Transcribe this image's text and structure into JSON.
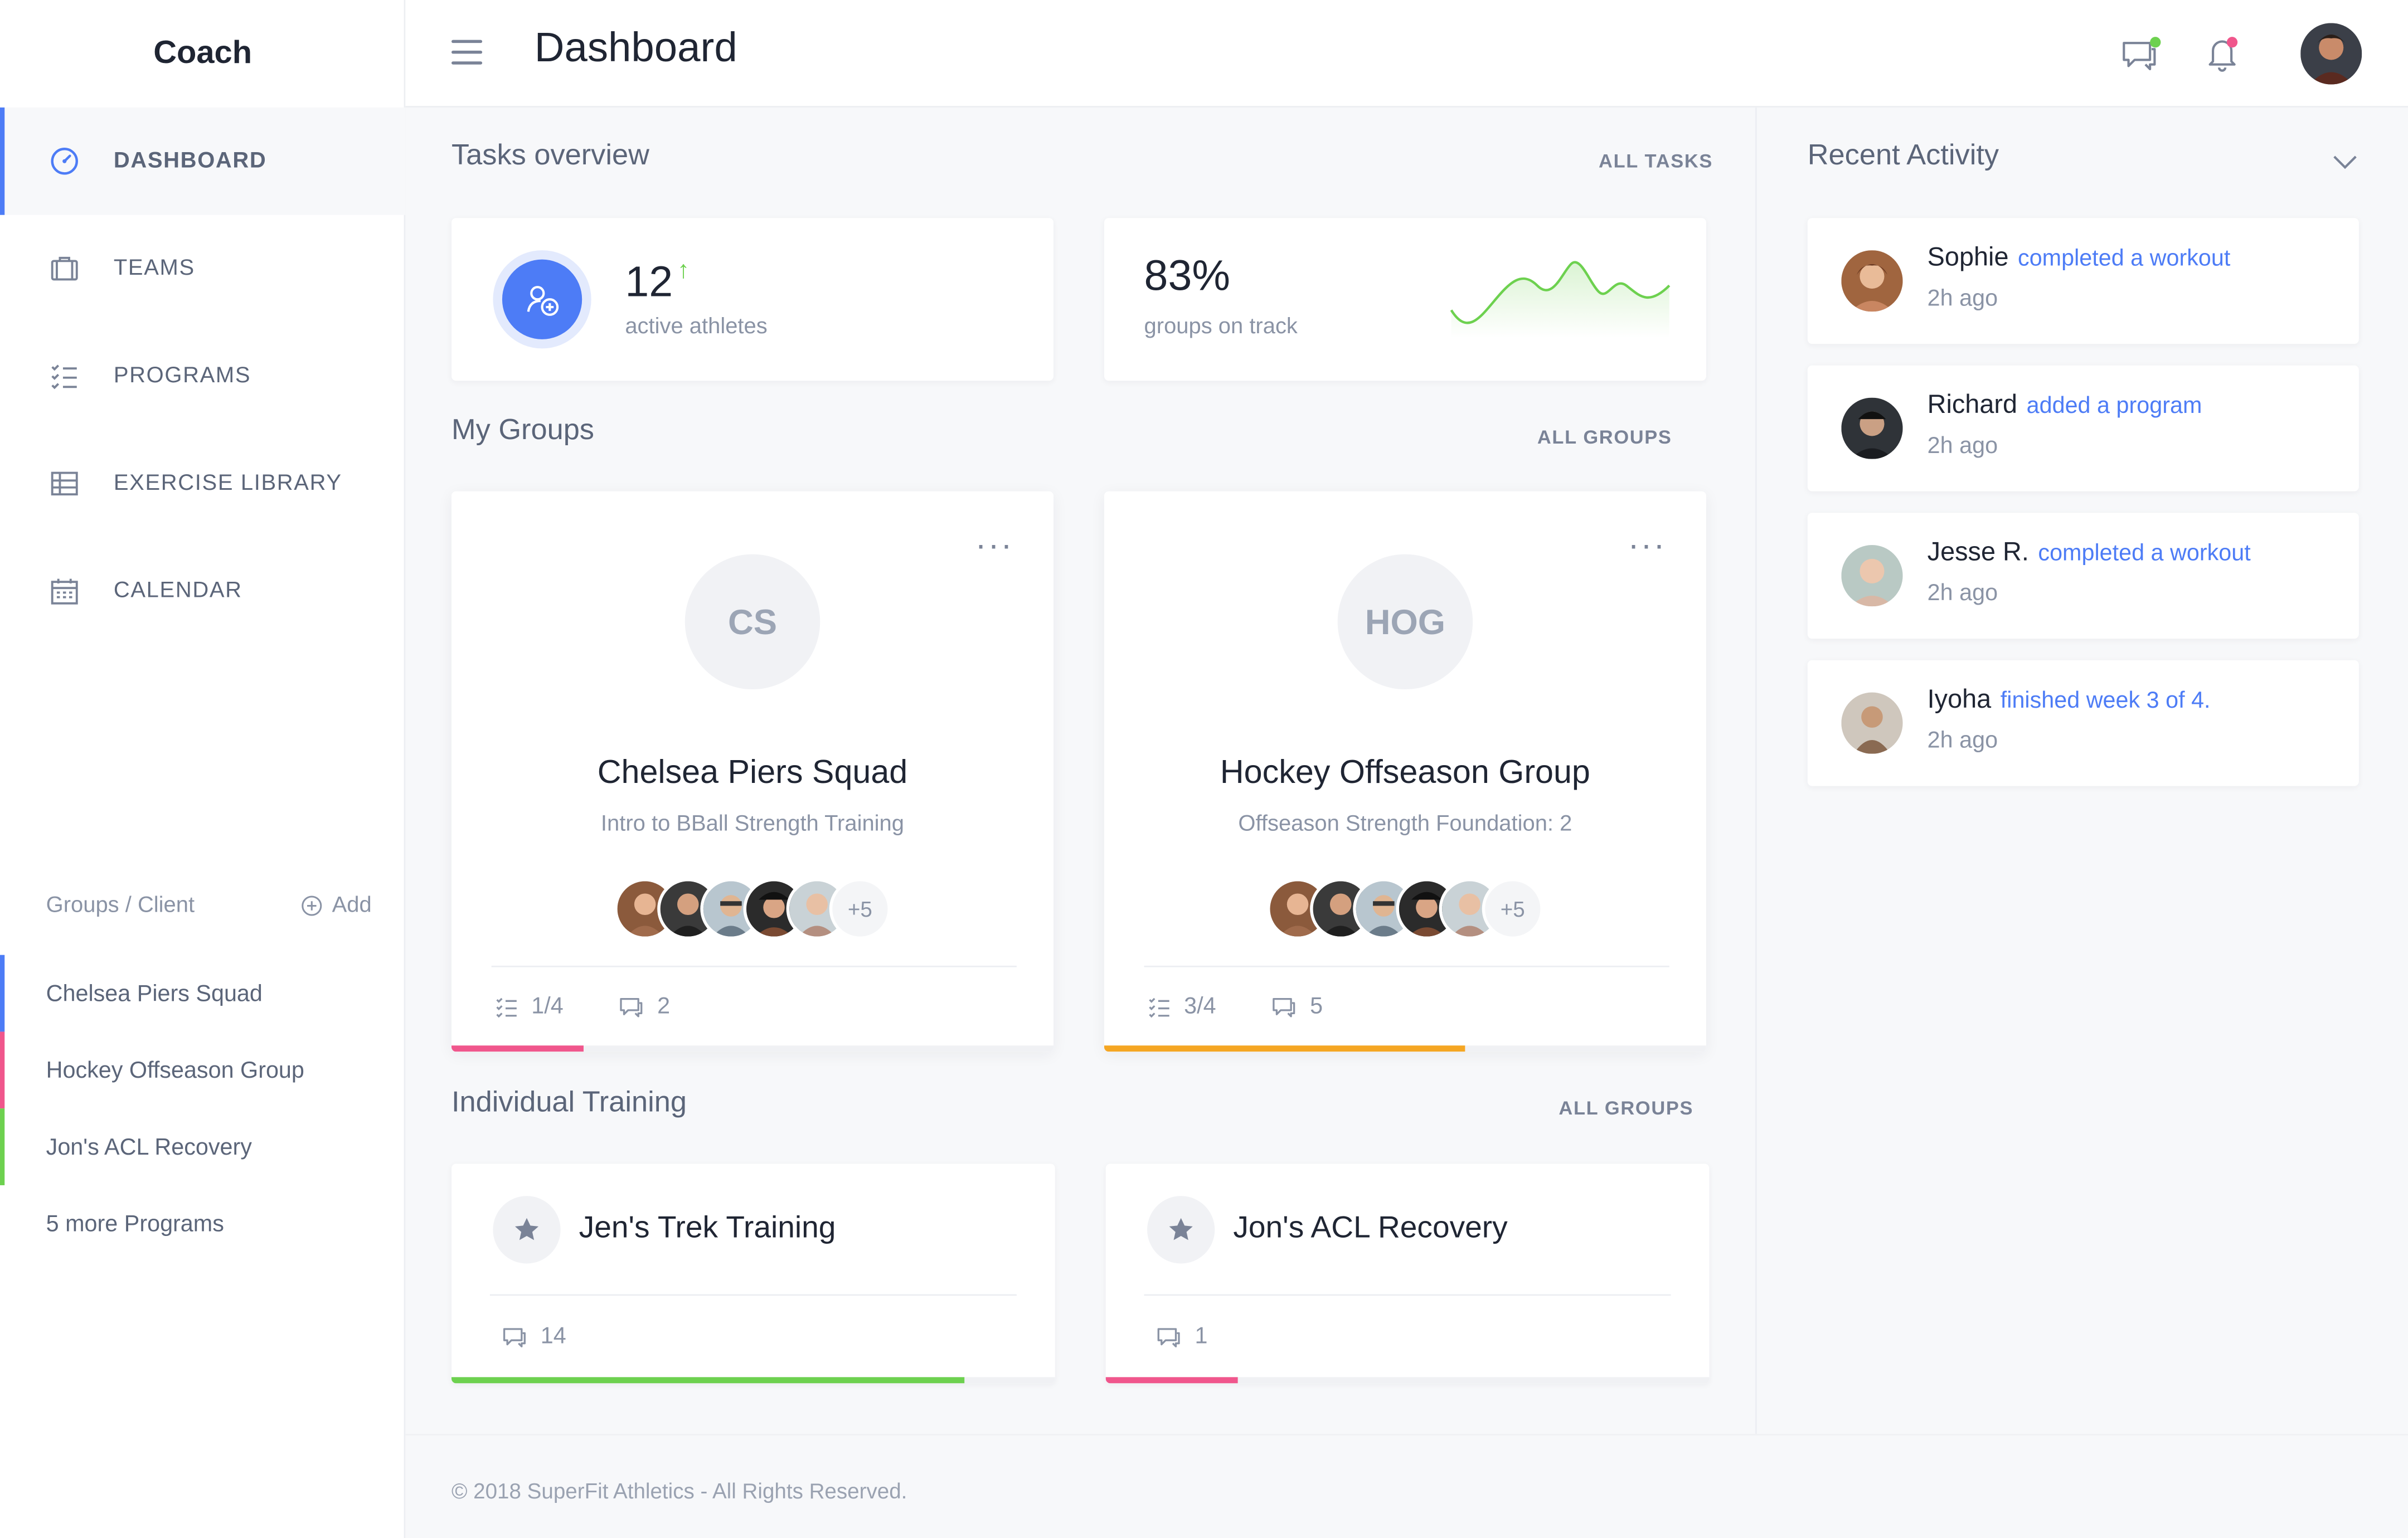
{
  "app": {
    "brand": "Coach"
  },
  "header": {
    "title": "Dashboard"
  },
  "sidebar": {
    "items": [
      {
        "label": "DASHBOARD",
        "icon": "speedometer-icon",
        "active": true
      },
      {
        "label": "TEAMS",
        "icon": "briefcase-icon",
        "active": false
      },
      {
        "label": "PROGRAMS",
        "icon": "checklist-icon",
        "active": false
      },
      {
        "label": "EXERCISE LIBRARY",
        "icon": "table-icon",
        "active": false
      },
      {
        "label": "CALENDAR",
        "icon": "calendar-icon",
        "active": false
      }
    ],
    "groups_title": "Groups / Client",
    "add_label": "Add",
    "groups": [
      {
        "label": "Chelsea Piers Squad",
        "color": "#4d7cf6"
      },
      {
        "label": "Hockey Offseason Group",
        "color": "#f0568c"
      },
      {
        "label": "Jon's ACL Recovery",
        "color": "#6dd14f"
      },
      {
        "label": "5 more Programs",
        "color": ""
      }
    ]
  },
  "tasks": {
    "title": "Tasks overview",
    "link": "ALL TASKS",
    "athletes": {
      "value": "12",
      "label": "active athletes",
      "trend": "↑"
    },
    "groups": {
      "value": "83%",
      "label": "groups on track"
    }
  },
  "my_groups": {
    "title": "My Groups",
    "link": "ALL GROUPS",
    "cards": [
      {
        "initials": "CS",
        "name": "Chelsea Piers Squad",
        "program": "Intro to BBall Strength Training",
        "more_count": "+5",
        "tasks": "1/4",
        "comments": "2",
        "progress": 0.22,
        "color": "#f0568c"
      },
      {
        "initials": "HOG",
        "name": "Hockey Offseason Group",
        "program": "Offseason Strength  Foundation: 2",
        "more_count": "+5",
        "tasks": "3/4",
        "comments": "5",
        "progress": 0.6,
        "color": "#f5a623"
      }
    ]
  },
  "individual": {
    "title": "Individual Training",
    "link": "ALL GROUPS",
    "cards": [
      {
        "name": "Jen's Trek Training",
        "comments": "14",
        "progress": 0.85,
        "color": "#6dd14f"
      },
      {
        "name": "Jon's ACL Recovery",
        "comments": "1",
        "progress": 0.22,
        "color": "#f0568c"
      }
    ]
  },
  "activity": {
    "title": "Recent Activity",
    "items": [
      {
        "name": "Sophie",
        "action": "completed a workout",
        "time": "2h ago"
      },
      {
        "name": "Richard",
        "action": "added a program",
        "time": "2h ago"
      },
      {
        "name": "Jesse R.",
        "action": "completed a workout",
        "time": "2h ago"
      },
      {
        "name": "Iyoha",
        "action": "finished week 3 of 4.",
        "time": "2h ago"
      }
    ]
  },
  "footer": {
    "text": "© 2018 SuperFit Athletics - All Rights Reserved."
  },
  "colors": {
    "accent": "#4d7cf6",
    "online": "#6dd14f",
    "alert": "#f0568c"
  }
}
